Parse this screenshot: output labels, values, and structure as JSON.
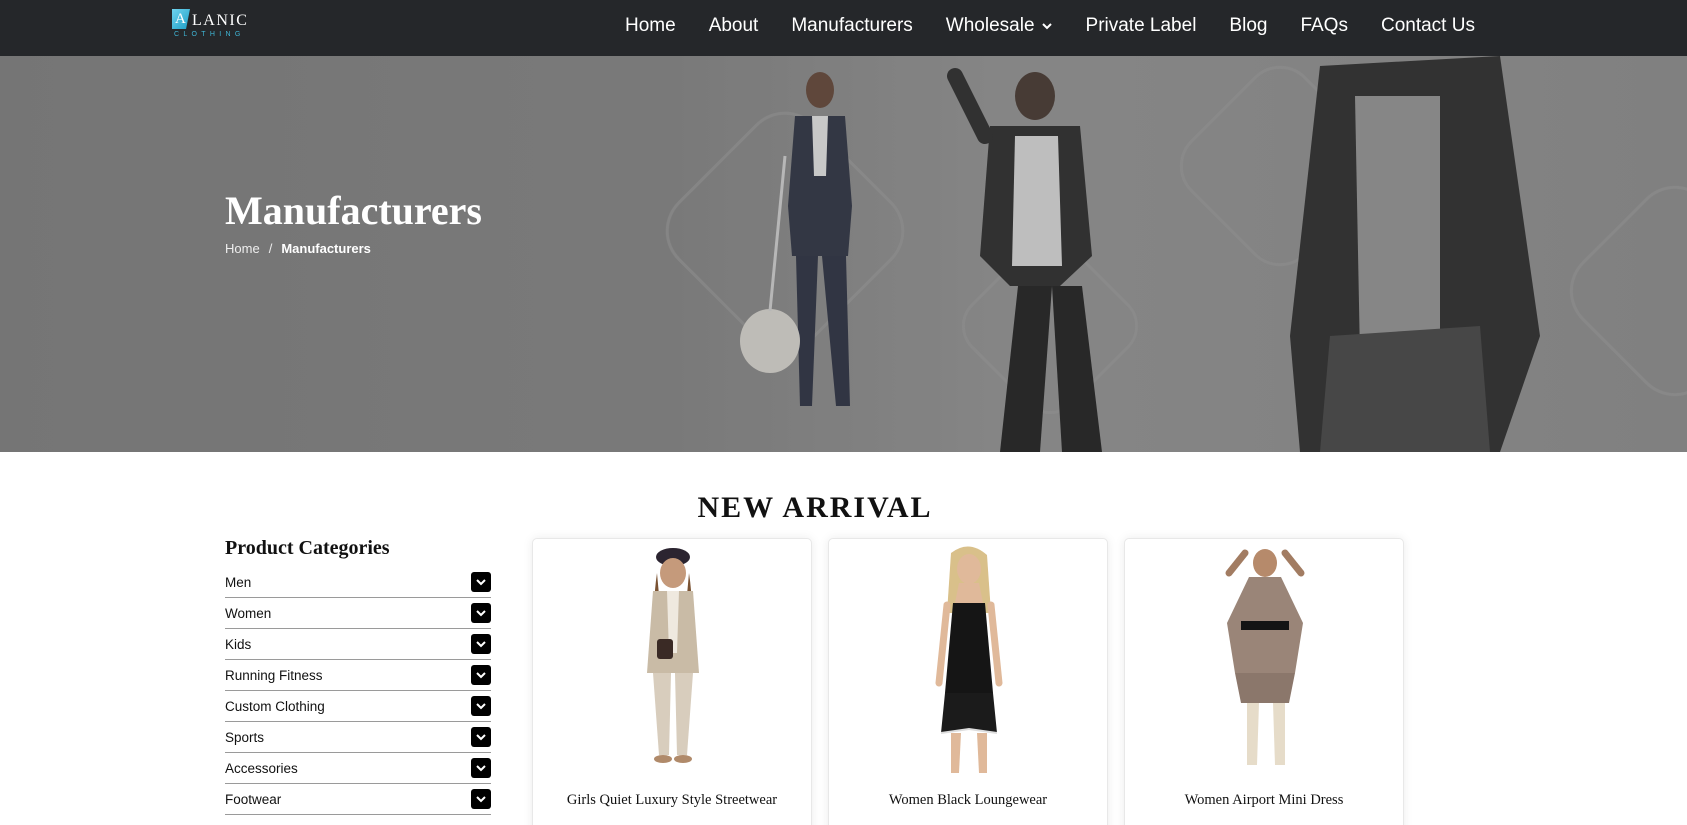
{
  "brand": {
    "logo_letter": "A",
    "logo_word": "LANIC",
    "logo_sub": "CLOTHING",
    "accent": "#3fb6d6"
  },
  "nav": {
    "items": [
      {
        "label": "Home"
      },
      {
        "label": "About"
      },
      {
        "label": "Manufacturers"
      },
      {
        "label": "Wholesale",
        "has_dropdown": true
      },
      {
        "label": "Private Label"
      },
      {
        "label": "Blog"
      },
      {
        "label": "FAQs"
      },
      {
        "label": "Contact Us"
      }
    ],
    "background": "#25272a"
  },
  "hero": {
    "title": "Manufacturers",
    "breadcrumb": {
      "home": "Home",
      "separator": "/",
      "current": "Manufacturers"
    }
  },
  "section": {
    "title": "NEW ARRIVAL"
  },
  "sidebar": {
    "heading": "Product Categories",
    "categories": [
      {
        "label": "Men"
      },
      {
        "label": "Women"
      },
      {
        "label": "Kids"
      },
      {
        "label": "Running Fitness"
      },
      {
        "label": "Custom Clothing"
      },
      {
        "label": "Sports"
      },
      {
        "label": "Accessories"
      },
      {
        "label": "Footwear"
      }
    ]
  },
  "products": [
    {
      "title": "Girls Quiet Luxury Style Streetwear",
      "image": "girl-beige-outfit-photo"
    },
    {
      "title": "Women Black Loungewear",
      "image": "woman-black-satin-romper-photo"
    },
    {
      "title": "Women Airport Mini Dress",
      "image": "woman-sweater-dress-photo"
    }
  ]
}
